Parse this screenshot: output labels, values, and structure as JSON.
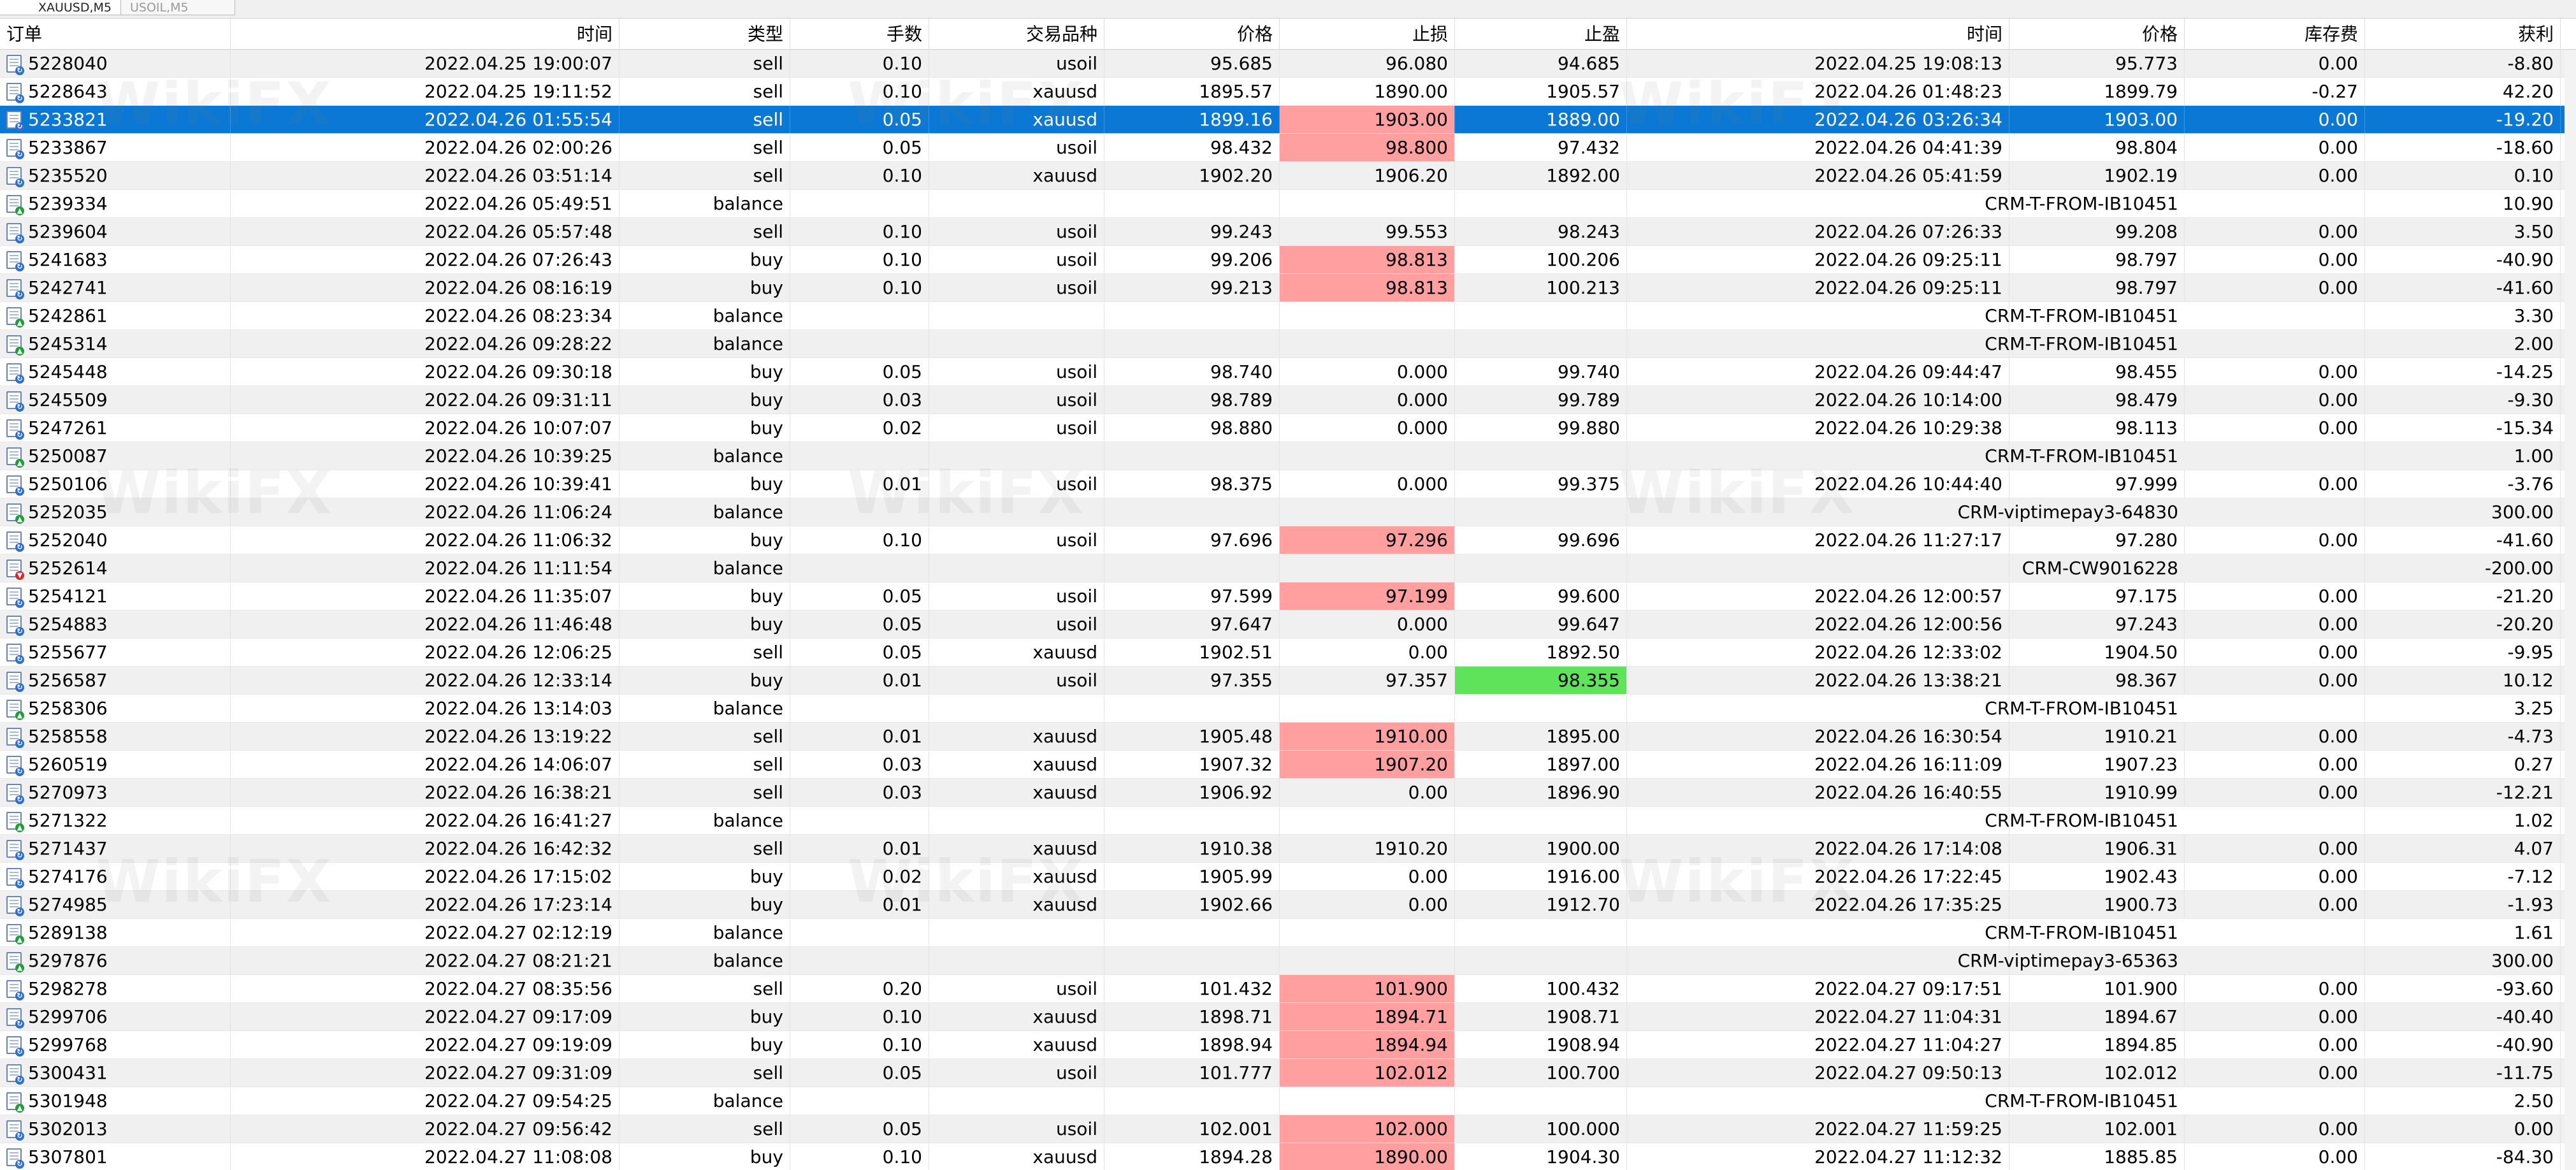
{
  "tabs": [
    "XAUUSD,M5",
    "USOIL,M5"
  ],
  "columns": [
    "订单",
    "时间",
    "类型",
    "手数",
    "交易品种",
    "价格",
    "止损",
    "止盈",
    "时间",
    "价格",
    "库存费",
    "获利"
  ],
  "watermark": "WikiFX",
  "colors": {
    "selected": "#0a78d4",
    "sl_highlight": "#ff9f9f",
    "tp_highlight": "#5ee35a"
  },
  "rows": [
    {
      "order": "5228040",
      "time": "2022.04.25 19:00:07",
      "type": "sell",
      "lots": "0.10",
      "symbol": "usoil",
      "price": "95.685",
      "sl": "96.080",
      "tp": "94.685",
      "close_time": "2022.04.25 19:08:13",
      "close_price": "95.773",
      "swap": "0.00",
      "profit": "-8.80",
      "icon": "trade",
      "sl_hl": false,
      "tp_hl": false,
      "selected": false
    },
    {
      "order": "5228643",
      "time": "2022.04.25 19:11:52",
      "type": "sell",
      "lots": "0.10",
      "symbol": "xauusd",
      "price": "1895.57",
      "sl": "1890.00",
      "tp": "1905.57",
      "close_time": "2022.04.26 01:48:23",
      "close_price": "1899.79",
      "swap": "-0.27",
      "profit": "42.20",
      "icon": "trade",
      "sl_hl": false,
      "tp_hl": false,
      "selected": false
    },
    {
      "order": "5233821",
      "time": "2022.04.26 01:55:54",
      "type": "sell",
      "lots": "0.05",
      "symbol": "xauusd",
      "price": "1899.16",
      "sl": "1903.00",
      "tp": "1889.00",
      "close_time": "2022.04.26 03:26:34",
      "close_price": "1903.00",
      "swap": "0.00",
      "profit": "-19.20",
      "icon": "trade",
      "sl_hl": true,
      "tp_hl": false,
      "selected": true
    },
    {
      "order": "5233867",
      "time": "2022.04.26 02:00:26",
      "type": "sell",
      "lots": "0.05",
      "symbol": "usoil",
      "price": "98.432",
      "sl": "98.800",
      "tp": "97.432",
      "close_time": "2022.04.26 04:41:39",
      "close_price": "98.804",
      "swap": "0.00",
      "profit": "-18.60",
      "icon": "trade",
      "sl_hl": true,
      "tp_hl": false,
      "selected": false
    },
    {
      "order": "5235520",
      "time": "2022.04.26 03:51:14",
      "type": "sell",
      "lots": "0.10",
      "symbol": "xauusd",
      "price": "1902.20",
      "sl": "1906.20",
      "tp": "1892.00",
      "close_time": "2022.04.26 05:41:59",
      "close_price": "1902.19",
      "swap": "0.00",
      "profit": "0.10",
      "icon": "trade",
      "sl_hl": false,
      "tp_hl": false,
      "selected": false
    },
    {
      "order": "5239334",
      "time": "2022.04.26 05:49:51",
      "type": "balance",
      "comment": "CRM-T-FROM-IB10451",
      "profit": "10.90",
      "icon": "deposit",
      "selected": false
    },
    {
      "order": "5239604",
      "time": "2022.04.26 05:57:48",
      "type": "sell",
      "lots": "0.10",
      "symbol": "usoil",
      "price": "99.243",
      "sl": "99.553",
      "tp": "98.243",
      "close_time": "2022.04.26 07:26:33",
      "close_price": "99.208",
      "swap": "0.00",
      "profit": "3.50",
      "icon": "trade",
      "sl_hl": false,
      "tp_hl": false,
      "selected": false
    },
    {
      "order": "5241683",
      "time": "2022.04.26 07:26:43",
      "type": "buy",
      "lots": "0.10",
      "symbol": "usoil",
      "price": "99.206",
      "sl": "98.813",
      "tp": "100.206",
      "close_time": "2022.04.26 09:25:11",
      "close_price": "98.797",
      "swap": "0.00",
      "profit": "-40.90",
      "icon": "trade",
      "sl_hl": true,
      "tp_hl": false,
      "selected": false
    },
    {
      "order": "5242741",
      "time": "2022.04.26 08:16:19",
      "type": "buy",
      "lots": "0.10",
      "symbol": "usoil",
      "price": "99.213",
      "sl": "98.813",
      "tp": "100.213",
      "close_time": "2022.04.26 09:25:11",
      "close_price": "98.797",
      "swap": "0.00",
      "profit": "-41.60",
      "icon": "trade",
      "sl_hl": true,
      "tp_hl": false,
      "selected": false
    },
    {
      "order": "5242861",
      "time": "2022.04.26 08:23:34",
      "type": "balance",
      "comment": "CRM-T-FROM-IB10451",
      "profit": "3.30",
      "icon": "deposit",
      "selected": false
    },
    {
      "order": "5245314",
      "time": "2022.04.26 09:28:22",
      "type": "balance",
      "comment": "CRM-T-FROM-IB10451",
      "profit": "2.00",
      "icon": "deposit",
      "selected": false
    },
    {
      "order": "5245448",
      "time": "2022.04.26 09:30:18",
      "type": "buy",
      "lots": "0.05",
      "symbol": "usoil",
      "price": "98.740",
      "sl": "0.000",
      "tp": "99.740",
      "close_time": "2022.04.26 09:44:47",
      "close_price": "98.455",
      "swap": "0.00",
      "profit": "-14.25",
      "icon": "trade",
      "sl_hl": false,
      "tp_hl": false,
      "selected": false
    },
    {
      "order": "5245509",
      "time": "2022.04.26 09:31:11",
      "type": "buy",
      "lots": "0.03",
      "symbol": "usoil",
      "price": "98.789",
      "sl": "0.000",
      "tp": "99.789",
      "close_time": "2022.04.26 10:14:00",
      "close_price": "98.479",
      "swap": "0.00",
      "profit": "-9.30",
      "icon": "trade",
      "sl_hl": false,
      "tp_hl": false,
      "selected": false
    },
    {
      "order": "5247261",
      "time": "2022.04.26 10:07:07",
      "type": "buy",
      "lots": "0.02",
      "symbol": "usoil",
      "price": "98.880",
      "sl": "0.000",
      "tp": "99.880",
      "close_time": "2022.04.26 10:29:38",
      "close_price": "98.113",
      "swap": "0.00",
      "profit": "-15.34",
      "icon": "trade",
      "sl_hl": false,
      "tp_hl": false,
      "selected": false
    },
    {
      "order": "5250087",
      "time": "2022.04.26 10:39:25",
      "type": "balance",
      "comment": "CRM-T-FROM-IB10451",
      "profit": "1.00",
      "icon": "deposit",
      "selected": false
    },
    {
      "order": "5250106",
      "time": "2022.04.26 10:39:41",
      "type": "buy",
      "lots": "0.01",
      "symbol": "usoil",
      "price": "98.375",
      "sl": "0.000",
      "tp": "99.375",
      "close_time": "2022.04.26 10:44:40",
      "close_price": "97.999",
      "swap": "0.00",
      "profit": "-3.76",
      "icon": "trade",
      "sl_hl": false,
      "tp_hl": false,
      "selected": false
    },
    {
      "order": "5252035",
      "time": "2022.04.26 11:06:24",
      "type": "balance",
      "comment": "CRM-viptimepay3-64830",
      "profit": "300.00",
      "icon": "deposit",
      "selected": false
    },
    {
      "order": "5252040",
      "time": "2022.04.26 11:06:32",
      "type": "buy",
      "lots": "0.10",
      "symbol": "usoil",
      "price": "97.696",
      "sl": "97.296",
      "tp": "99.696",
      "close_time": "2022.04.26 11:27:17",
      "close_price": "97.280",
      "swap": "0.00",
      "profit": "-41.60",
      "icon": "trade",
      "sl_hl": true,
      "tp_hl": false,
      "selected": false
    },
    {
      "order": "5252614",
      "time": "2022.04.26 11:11:54",
      "type": "balance",
      "comment": "CRM-CW9016228",
      "profit": "-200.00",
      "icon": "withdraw",
      "selected": false
    },
    {
      "order": "5254121",
      "time": "2022.04.26 11:35:07",
      "type": "buy",
      "lots": "0.05",
      "symbol": "usoil",
      "price": "97.599",
      "sl": "97.199",
      "tp": "99.600",
      "close_time": "2022.04.26 12:00:57",
      "close_price": "97.175",
      "swap": "0.00",
      "profit": "-21.20",
      "icon": "trade",
      "sl_hl": true,
      "tp_hl": false,
      "selected": false
    },
    {
      "order": "5254883",
      "time": "2022.04.26 11:46:48",
      "type": "buy",
      "lots": "0.05",
      "symbol": "usoil",
      "price": "97.647",
      "sl": "0.000",
      "tp": "99.647",
      "close_time": "2022.04.26 12:00:56",
      "close_price": "97.243",
      "swap": "0.00",
      "profit": "-20.20",
      "icon": "trade",
      "sl_hl": false,
      "tp_hl": false,
      "selected": false
    },
    {
      "order": "5255677",
      "time": "2022.04.26 12:06:25",
      "type": "sell",
      "lots": "0.05",
      "symbol": "xauusd",
      "price": "1902.51",
      "sl": "0.00",
      "tp": "1892.50",
      "close_time": "2022.04.26 12:33:02",
      "close_price": "1904.50",
      "swap": "0.00",
      "profit": "-9.95",
      "icon": "trade",
      "sl_hl": false,
      "tp_hl": false,
      "selected": false
    },
    {
      "order": "5256587",
      "time": "2022.04.26 12:33:14",
      "type": "buy",
      "lots": "0.01",
      "symbol": "usoil",
      "price": "97.355",
      "sl": "97.357",
      "tp": "98.355",
      "close_time": "2022.04.26 13:38:21",
      "close_price": "98.367",
      "swap": "0.00",
      "profit": "10.12",
      "icon": "trade",
      "sl_hl": false,
      "tp_hl": true,
      "selected": false
    },
    {
      "order": "5258306",
      "time": "2022.04.26 13:14:03",
      "type": "balance",
      "comment": "CRM-T-FROM-IB10451",
      "profit": "3.25",
      "icon": "deposit",
      "selected": false
    },
    {
      "order": "5258558",
      "time": "2022.04.26 13:19:22",
      "type": "sell",
      "lots": "0.01",
      "symbol": "xauusd",
      "price": "1905.48",
      "sl": "1910.00",
      "tp": "1895.00",
      "close_time": "2022.04.26 16:30:54",
      "close_price": "1910.21",
      "swap": "0.00",
      "profit": "-4.73",
      "icon": "trade",
      "sl_hl": true,
      "tp_hl": false,
      "selected": false
    },
    {
      "order": "5260519",
      "time": "2022.04.26 14:06:07",
      "type": "sell",
      "lots": "0.03",
      "symbol": "xauusd",
      "price": "1907.32",
      "sl": "1907.20",
      "tp": "1897.00",
      "close_time": "2022.04.26 16:11:09",
      "close_price": "1907.23",
      "swap": "0.00",
      "profit": "0.27",
      "icon": "trade",
      "sl_hl": true,
      "tp_hl": false,
      "selected": false
    },
    {
      "order": "5270973",
      "time": "2022.04.26 16:38:21",
      "type": "sell",
      "lots": "0.03",
      "symbol": "xauusd",
      "price": "1906.92",
      "sl": "0.00",
      "tp": "1896.90",
      "close_time": "2022.04.26 16:40:55",
      "close_price": "1910.99",
      "swap": "0.00",
      "profit": "-12.21",
      "icon": "trade",
      "sl_hl": false,
      "tp_hl": false,
      "selected": false
    },
    {
      "order": "5271322",
      "time": "2022.04.26 16:41:27",
      "type": "balance",
      "comment": "CRM-T-FROM-IB10451",
      "profit": "1.02",
      "icon": "deposit",
      "selected": false
    },
    {
      "order": "5271437",
      "time": "2022.04.26 16:42:32",
      "type": "sell",
      "lots": "0.01",
      "symbol": "xauusd",
      "price": "1910.38",
      "sl": "1910.20",
      "tp": "1900.00",
      "close_time": "2022.04.26 17:14:08",
      "close_price": "1906.31",
      "swap": "0.00",
      "profit": "4.07",
      "icon": "trade",
      "sl_hl": false,
      "tp_hl": false,
      "selected": false
    },
    {
      "order": "5274176",
      "time": "2022.04.26 17:15:02",
      "type": "buy",
      "lots": "0.02",
      "symbol": "xauusd",
      "price": "1905.99",
      "sl": "0.00",
      "tp": "1916.00",
      "close_time": "2022.04.26 17:22:45",
      "close_price": "1902.43",
      "swap": "0.00",
      "profit": "-7.12",
      "icon": "trade",
      "sl_hl": false,
      "tp_hl": false,
      "selected": false
    },
    {
      "order": "5274985",
      "time": "2022.04.26 17:23:14",
      "type": "buy",
      "lots": "0.01",
      "symbol": "xauusd",
      "price": "1902.66",
      "sl": "0.00",
      "tp": "1912.70",
      "close_time": "2022.04.26 17:35:25",
      "close_price": "1900.73",
      "swap": "0.00",
      "profit": "-1.93",
      "icon": "trade",
      "sl_hl": false,
      "tp_hl": false,
      "selected": false
    },
    {
      "order": "5289138",
      "time": "2022.04.27 02:12:19",
      "type": "balance",
      "comment": "CRM-T-FROM-IB10451",
      "profit": "1.61",
      "icon": "deposit",
      "selected": false
    },
    {
      "order": "5297876",
      "time": "2022.04.27 08:21:21",
      "type": "balance",
      "comment": "CRM-viptimepay3-65363",
      "profit": "300.00",
      "icon": "deposit",
      "selected": false
    },
    {
      "order": "5298278",
      "time": "2022.04.27 08:35:56",
      "type": "sell",
      "lots": "0.20",
      "symbol": "usoil",
      "price": "101.432",
      "sl": "101.900",
      "tp": "100.432",
      "close_time": "2022.04.27 09:17:51",
      "close_price": "101.900",
      "swap": "0.00",
      "profit": "-93.60",
      "icon": "trade",
      "sl_hl": true,
      "tp_hl": false,
      "selected": false
    },
    {
      "order": "5299706",
      "time": "2022.04.27 09:17:09",
      "type": "buy",
      "lots": "0.10",
      "symbol": "xauusd",
      "price": "1898.71",
      "sl": "1894.71",
      "tp": "1908.71",
      "close_time": "2022.04.27 11:04:31",
      "close_price": "1894.67",
      "swap": "0.00",
      "profit": "-40.40",
      "icon": "trade",
      "sl_hl": true,
      "tp_hl": false,
      "selected": false
    },
    {
      "order": "5299768",
      "time": "2022.04.27 09:19:09",
      "type": "buy",
      "lots": "0.10",
      "symbol": "xauusd",
      "price": "1898.94",
      "sl": "1894.94",
      "tp": "1908.94",
      "close_time": "2022.04.27 11:04:27",
      "close_price": "1894.85",
      "swap": "0.00",
      "profit": "-40.90",
      "icon": "trade",
      "sl_hl": true,
      "tp_hl": false,
      "selected": false
    },
    {
      "order": "5300431",
      "time": "2022.04.27 09:31:09",
      "type": "sell",
      "lots": "0.05",
      "symbol": "usoil",
      "price": "101.777",
      "sl": "102.012",
      "tp": "100.700",
      "close_time": "2022.04.27 09:50:13",
      "close_price": "102.012",
      "swap": "0.00",
      "profit": "-11.75",
      "icon": "trade",
      "sl_hl": true,
      "tp_hl": false,
      "selected": false
    },
    {
      "order": "5301948",
      "time": "2022.04.27 09:54:25",
      "type": "balance",
      "comment": "CRM-T-FROM-IB10451",
      "profit": "2.50",
      "icon": "deposit",
      "selected": false
    },
    {
      "order": "5302013",
      "time": "2022.04.27 09:56:42",
      "type": "sell",
      "lots": "0.05",
      "symbol": "usoil",
      "price": "102.001",
      "sl": "102.000",
      "tp": "100.000",
      "close_time": "2022.04.27 11:59:25",
      "close_price": "102.001",
      "swap": "0.00",
      "profit": "0.00",
      "icon": "trade",
      "sl_hl": true,
      "tp_hl": false,
      "selected": false
    },
    {
      "order": "5307801",
      "time": "2022.04.27 11:08:08",
      "type": "buy",
      "lots": "0.10",
      "symbol": "xauusd",
      "price": "1894.28",
      "sl": "1890.00",
      "tp": "1904.30",
      "close_time": "2022.04.27 11:12:32",
      "close_price": "1885.85",
      "swap": "0.00",
      "profit": "-84.30",
      "icon": "trade",
      "sl_hl": true,
      "tp_hl": false,
      "selected": false
    }
  ]
}
